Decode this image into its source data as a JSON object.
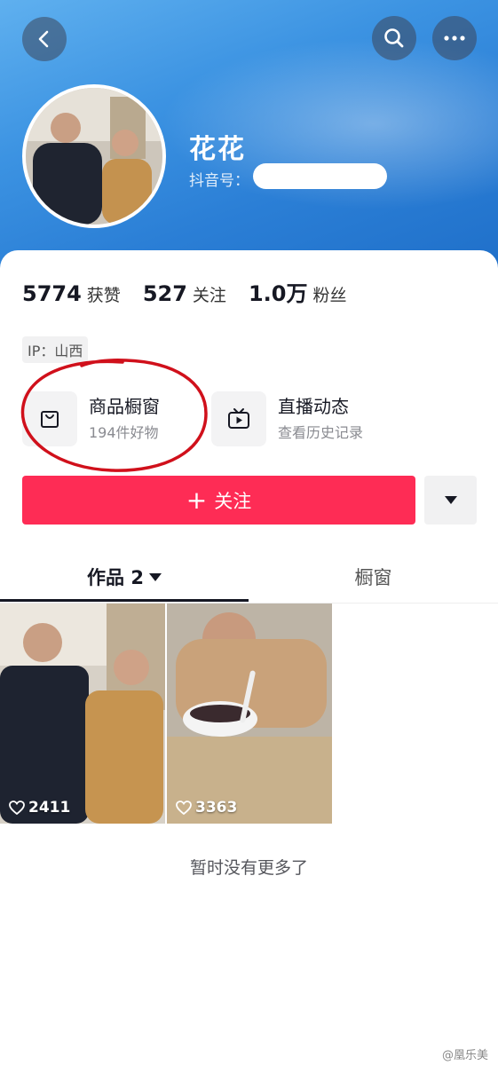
{
  "header": {
    "nickname": "花花",
    "douyin_id_label": "抖音号："
  },
  "stats": [
    {
      "value": "5774",
      "label": "获赞"
    },
    {
      "value": "527",
      "label": "关注"
    },
    {
      "value": "1.0万",
      "label": "粉丝"
    }
  ],
  "ip_tag": "IP：山西",
  "entries": {
    "shop": {
      "title": "商品橱窗",
      "subtitle": "194件好物"
    },
    "live": {
      "title": "直播动态",
      "subtitle": "查看历史记录"
    }
  },
  "actions": {
    "follow_label": "关注"
  },
  "tabs": {
    "works_label": "作品 2",
    "shop_label": "橱窗"
  },
  "videos": [
    {
      "likes": "2411"
    },
    {
      "likes": "3363"
    }
  ],
  "footer": {
    "no_more_text": "暂时没有更多了"
  },
  "watermark": {
    "text": "@凰乐美"
  },
  "colors": {
    "follow_button": "#fe2c55",
    "header_blue": "#3c93e2",
    "annotation_red": "#d0101b"
  }
}
